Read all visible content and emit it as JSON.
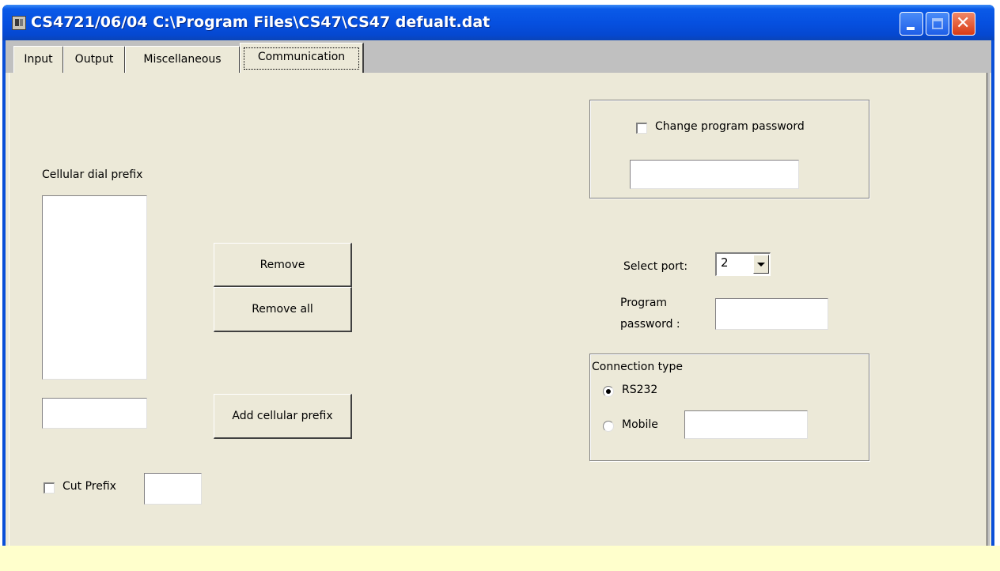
{
  "window": {
    "title": "CS4721/06/04  C:\\Program Files\\CS47\\CS47 defualt.dat",
    "buttons": {
      "minimize": "minimize",
      "maximize": "maximize",
      "close": "close"
    }
  },
  "tabs": [
    {
      "label": "Input",
      "active": false
    },
    {
      "label": "Output",
      "active": false
    },
    {
      "label": "Miscellaneous",
      "active": false
    },
    {
      "label": "Communication",
      "active": true
    }
  ],
  "cellular": {
    "label": "Cellular dial prefix",
    "items": [],
    "prefix_input_value": "",
    "remove_label": "Remove",
    "remove_all_label": "Remove all",
    "add_label": "Add cellular prefix",
    "cut_prefix_label": "Cut Prefix",
    "cut_prefix_checked": false,
    "cut_prefix_value": ""
  },
  "password_change": {
    "checkbox_label": "Change program password",
    "checked": false,
    "value": ""
  },
  "port": {
    "label": "Select port:",
    "selected": "2"
  },
  "program_password": {
    "label_line1": "Program",
    "label_line2": "password :",
    "value": ""
  },
  "connection": {
    "title": "Connection type",
    "options": [
      {
        "label": "RS232",
        "selected": true
      },
      {
        "label": "Mobile",
        "selected": false
      }
    ],
    "mobile_value": ""
  },
  "colors": {
    "titlebar": "#0a5ae8",
    "client": "#ece9d8",
    "tab_strip": "#c0c0c0",
    "tooltip_band": "#ffffcc"
  }
}
